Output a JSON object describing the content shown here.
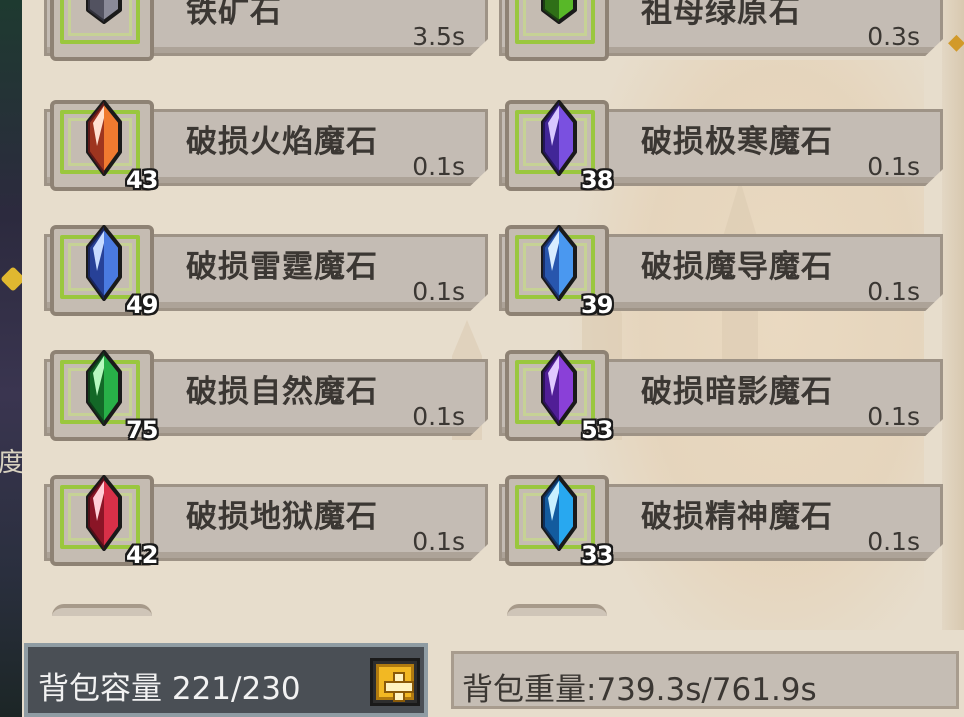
{
  "items": [
    {
      "name": "铁矿石",
      "time": "3.5s",
      "count": "",
      "gem": "iron"
    },
    {
      "name": "祖母绿原石",
      "time": "0.3s",
      "count": "",
      "gem": "emerald"
    },
    {
      "name": "破损火焰魔石",
      "time": "0.1s",
      "count": "43",
      "gem": "fire"
    },
    {
      "name": "破损极寒魔石",
      "time": "0.1s",
      "count": "38",
      "gem": "frost"
    },
    {
      "name": "破损雷霆魔石",
      "time": "0.1s",
      "count": "49",
      "gem": "thunder"
    },
    {
      "name": "破损魔导魔石",
      "time": "0.1s",
      "count": "39",
      "gem": "arcane"
    },
    {
      "name": "破损自然魔石",
      "time": "0.1s",
      "count": "75",
      "gem": "nature"
    },
    {
      "name": "破损暗影魔石",
      "time": "0.1s",
      "count": "53",
      "gem": "shadow"
    },
    {
      "name": "破损地狱魔石",
      "time": "0.1s",
      "count": "42",
      "gem": "hell"
    },
    {
      "name": "破损精神魔石",
      "time": "0.1s",
      "count": "33",
      "gem": "spirit"
    }
  ],
  "gem_colors": {
    "iron": {
      "light": "#d8d8e0",
      "mid": "#8a8a98",
      "dark": "#3a3a48"
    },
    "emerald": {
      "light": "#b8f070",
      "mid": "#58b828",
      "dark": "#1e5010"
    },
    "fire": {
      "light": "#ffe0d0",
      "mid": "#f07a30",
      "dark": "#7a1818"
    },
    "frost": {
      "light": "#d8c8ff",
      "mid": "#7a50e0",
      "dark": "#2a1478"
    },
    "thunder": {
      "light": "#c8dcff",
      "mid": "#4a7ae0",
      "dark": "#182a78"
    },
    "arcane": {
      "light": "#d8ecff",
      "mid": "#4a98f0",
      "dark": "#1a3a90"
    },
    "nature": {
      "light": "#b8f8c0",
      "mid": "#28b048",
      "dark": "#0a4a1a"
    },
    "shadow": {
      "light": "#e0c8ff",
      "mid": "#8a40d8",
      "dark": "#38107a"
    },
    "hell": {
      "light": "#ffd0d8",
      "mid": "#d83048",
      "dark": "#6a0a18"
    },
    "spirit": {
      "light": "#c8f0ff",
      "mid": "#28a8f0",
      "dark": "#0a3a7a"
    }
  },
  "footer": {
    "capacity_label": "背包容量 221/230",
    "weight_label": "背包重量:739.3s/761.9s"
  },
  "side_glyph": "度"
}
